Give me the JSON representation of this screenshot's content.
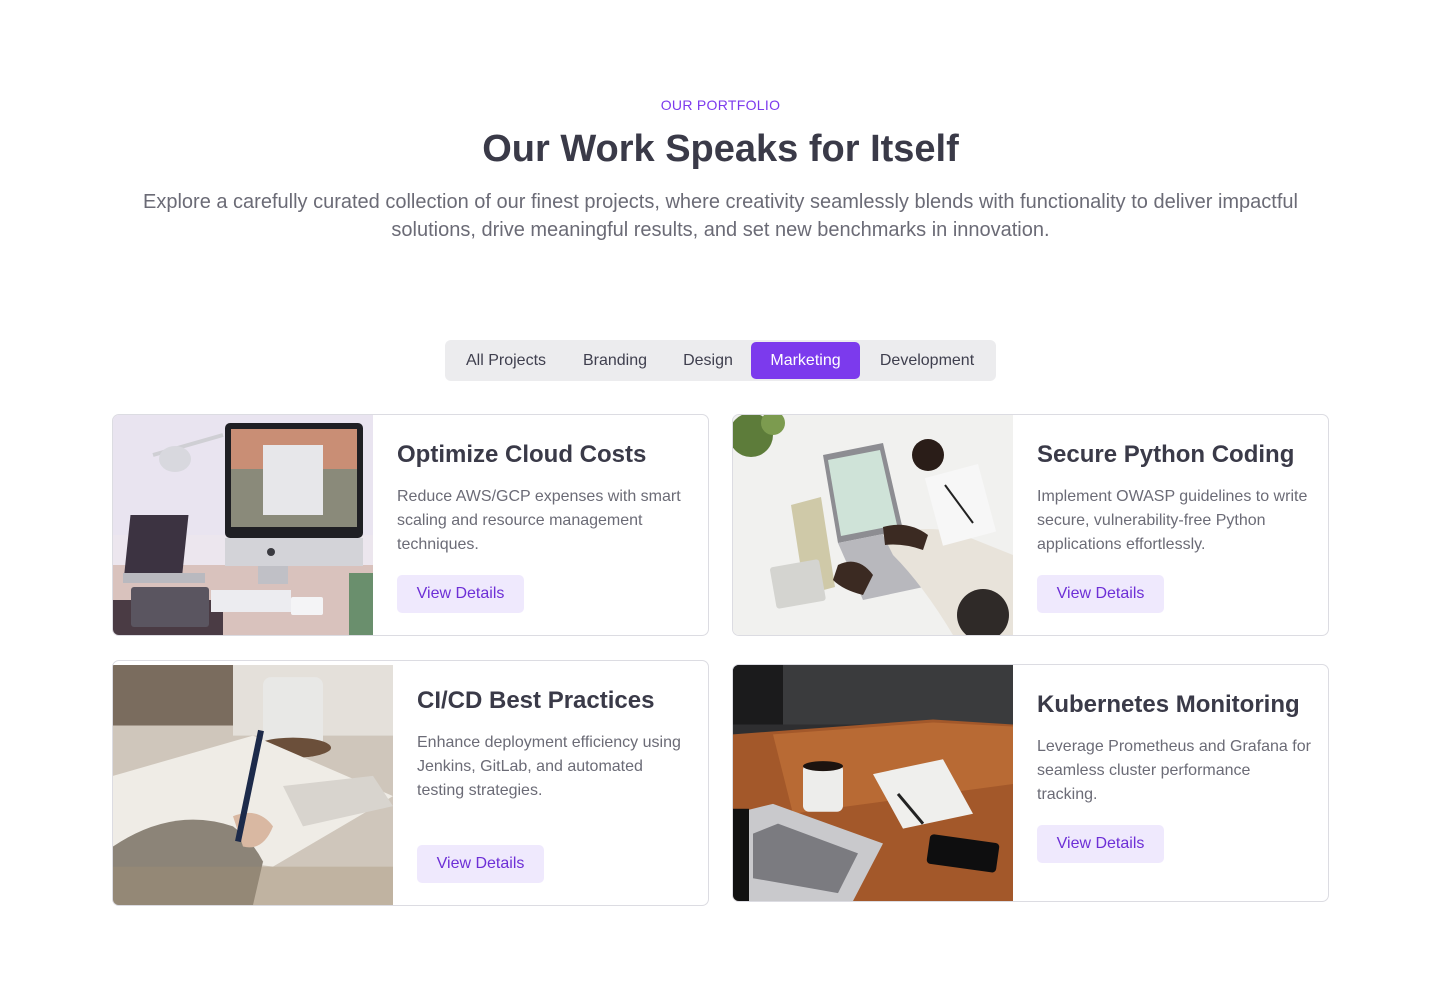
{
  "header": {
    "eyebrow": "OUR PORTFOLIO",
    "title": "Our Work Speaks for Itself",
    "intro": "Explore a carefully curated collection of our finest projects, where creativity seamlessly blends with functionality to deliver impactful solutions, drive meaningful results, and set new benchmarks in innovation."
  },
  "filters": {
    "items": [
      "All Projects",
      "Branding",
      "Design",
      "Marketing",
      "Development"
    ],
    "active": "Marketing"
  },
  "projects": [
    {
      "title": "Optimize Cloud Costs",
      "description": "Reduce AWS/GCP expenses with smart scaling and resource management techniques.",
      "button": "View Details",
      "image": "desk-imac-photo"
    },
    {
      "title": "Secure Python Coding",
      "description": "Implement OWASP guidelines to write secure, vulnerability-free Python applications effortlessly.",
      "button": "View Details",
      "image": "laptop-overhead-photo"
    },
    {
      "title": "CI/CD Best Practices",
      "description": "Enhance deployment efficiency using Jenkins, GitLab, and automated testing strategies.",
      "button": "View Details",
      "image": "writing-notebook-photo"
    },
    {
      "title": "Kubernetes Monitoring",
      "description": "Leverage Prometheus and Grafana for seamless cluster performance tracking.",
      "button": "View Details",
      "image": "laptop-coffee-table-photo"
    }
  ],
  "colors": {
    "accent": "#7c3aed",
    "button_bg": "#efe9fd",
    "text_heading": "#3a3a48",
    "text_body": "#6b6b76"
  }
}
